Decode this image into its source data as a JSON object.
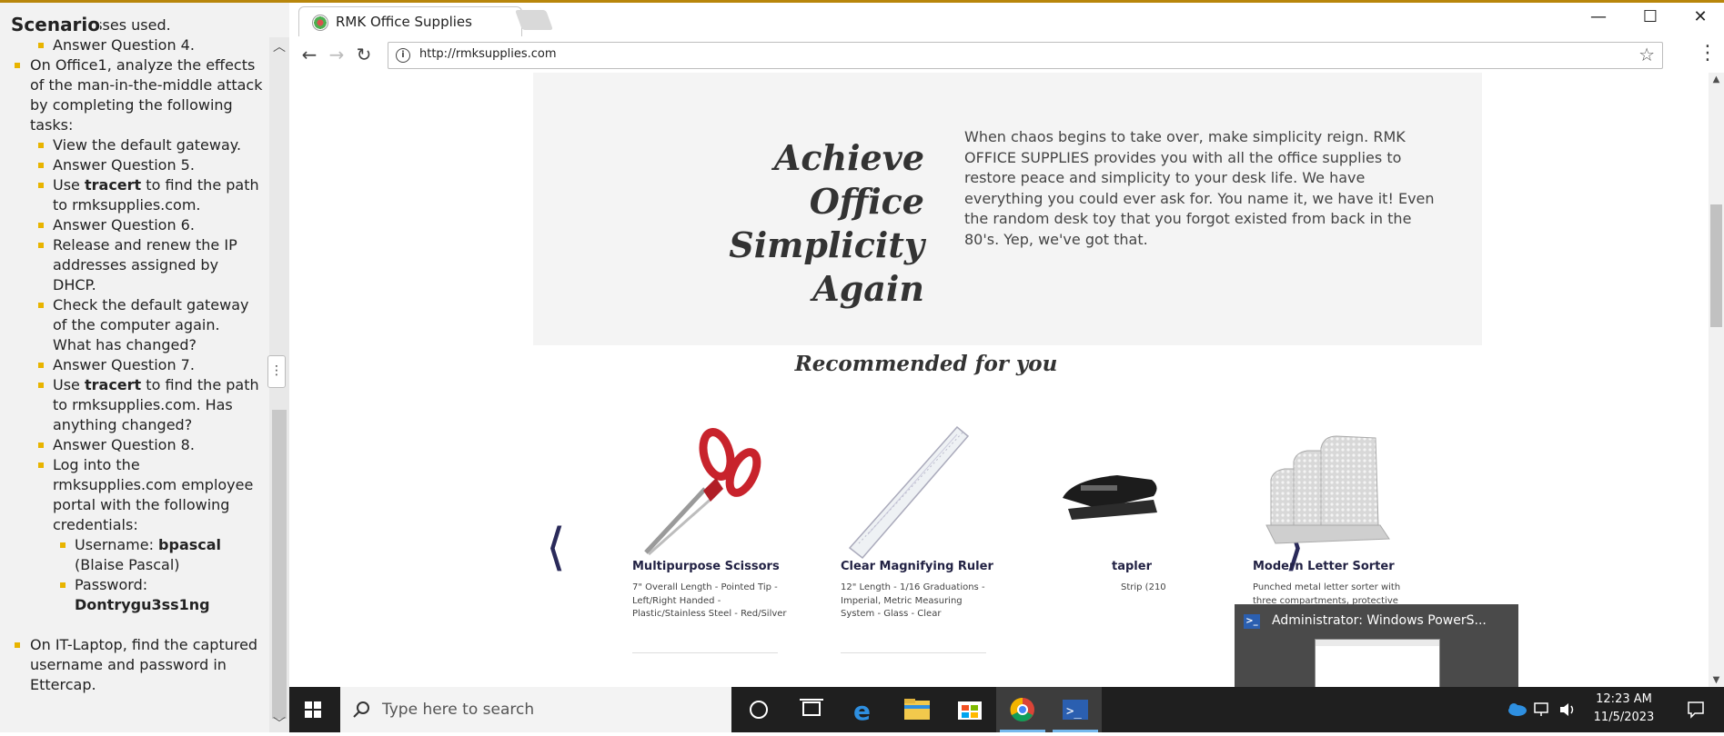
{
  "scenario": {
    "title": "Scenario",
    "lines": [
      {
        "text": "addresses used.",
        "level": 2,
        "bullet": false
      },
      {
        "text": "Answer Question 4.",
        "level": 2,
        "bullet": true
      },
      {
        "text": "On Office1, analyze the effects",
        "level": 1,
        "bullet": true
      },
      {
        "text": "of the man-in-the-middle attack",
        "level": 1,
        "bullet": false
      },
      {
        "text": "by completing the following",
        "level": 1,
        "bullet": false
      },
      {
        "text": "tasks:",
        "level": 1,
        "bullet": false
      },
      {
        "text": "View the default gateway.",
        "level": 2,
        "bullet": true
      },
      {
        "text": "Answer Question 5.",
        "level": 2,
        "bullet": true
      },
      {
        "pre": "Use ",
        "bold": "tracert",
        "post": " to find the path",
        "level": 2,
        "bullet": true
      },
      {
        "text": "to rmksupplies.com.",
        "level": 2,
        "bullet": false
      },
      {
        "text": "Answer Question 6.",
        "level": 2,
        "bullet": true
      },
      {
        "text": "Release and renew the IP",
        "level": 2,
        "bullet": true
      },
      {
        "text": "addresses assigned by",
        "level": 2,
        "bullet": false
      },
      {
        "text": "DHCP.",
        "level": 2,
        "bullet": false
      },
      {
        "text": "Check the default gateway",
        "level": 2,
        "bullet": true
      },
      {
        "text": "of the computer again.",
        "level": 2,
        "bullet": false
      },
      {
        "text": "What has changed?",
        "level": 2,
        "bullet": false
      },
      {
        "text": "Answer Question 7.",
        "level": 2,
        "bullet": true
      },
      {
        "pre": "Use ",
        "bold": "tracert",
        "post": " to find the path",
        "level": 2,
        "bullet": true
      },
      {
        "text": "to rmksupplies.com. Has",
        "level": 2,
        "bullet": false
      },
      {
        "text": "anything changed?",
        "level": 2,
        "bullet": false
      },
      {
        "text": "Answer Question 8.",
        "level": 2,
        "bullet": true
      },
      {
        "text": "Log into the",
        "level": 2,
        "bullet": true
      },
      {
        "text": "rmksupplies.com employee",
        "level": 2,
        "bullet": false
      },
      {
        "text": "portal with the following",
        "level": 2,
        "bullet": false
      },
      {
        "text": "credentials:",
        "level": 2,
        "bullet": false
      },
      {
        "pre": "Username: ",
        "bold": "bpascal",
        "post": "",
        "level": 3,
        "bullet": true
      },
      {
        "text": "(Blaise Pascal)",
        "level": 3,
        "bullet": false
      },
      {
        "text": "Password:",
        "level": 3,
        "bullet": true
      },
      {
        "pre": "",
        "bold": "Dontrygu3ss1ng",
        "post": "",
        "level": 3,
        "bullet": false
      },
      {
        "text": "",
        "level": 1,
        "bullet": false,
        "gap": true
      },
      {
        "text": "On IT-Laptop, find the captured",
        "level": 1,
        "bullet": true
      },
      {
        "text": "username and password in",
        "level": 1,
        "bullet": false
      },
      {
        "text": "Ettercap.",
        "level": 1,
        "bullet": false
      }
    ]
  },
  "browser": {
    "tab_title": "RMK Office Supplies",
    "url": "http://rmksupplies.com",
    "hero": {
      "title": "Achieve Office Simplicity Again",
      "text": "When chaos begins to take over, make simplicity reign. RMK OFFICE SUPPLIES provides you with all the office supplies to restore peace and simplicity to your desk life. We have everything you could ever ask for. You name it, we have it! Even the random desk toy that you forgot existed from back in the 80's. Yep, we've got that."
    },
    "recommended_title": "Recommended for you",
    "products": [
      {
        "name": "Multipurpose Scissors",
        "desc": "7\" Overall Length - Pointed Tip - Left/Right Handed - Plastic/Stainless Steel - Red/Silver"
      },
      {
        "name": "Clear Magnifying Ruler",
        "desc": "12\" Length - 1/16 Graduations - Imperial, Metric Measuring System - Glass - Clear"
      },
      {
        "name": "tapler",
        "desc": "Strip (210"
      },
      {
        "name": "Modern Letter Sorter",
        "desc": "Punched metal letter sorter with three compartments, protective feet and rounded edges."
      }
    ],
    "carousel_prev": "⟨",
    "carousel_next": "⟩"
  },
  "preview": {
    "title": "Administrator: Windows PowerS..."
  },
  "taskbar": {
    "search_placeholder": "Type here to search",
    "time": "12:23 AM",
    "date": "11/5/2023"
  },
  "colors": {
    "accent_bullet": "#e8b400",
    "taskbar": "#1f1f1f",
    "link_navy": "#222244"
  }
}
